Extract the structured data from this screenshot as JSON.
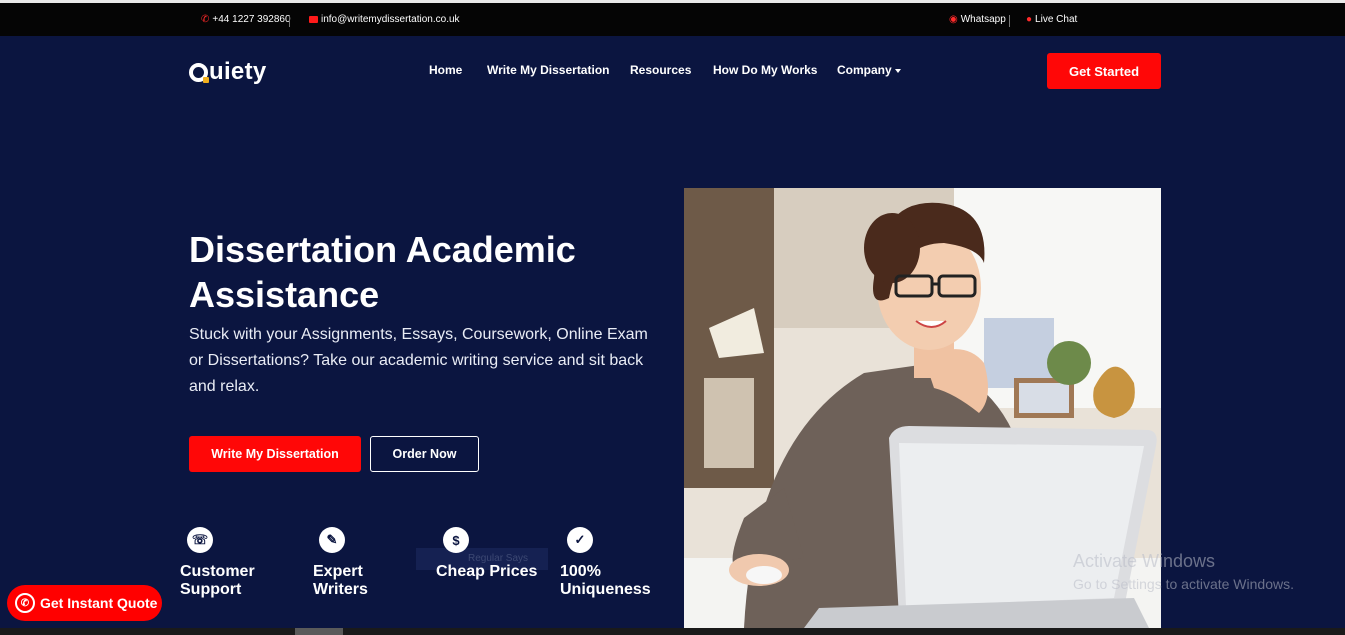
{
  "topbar": {
    "phone": "+44 1227 392860",
    "email": "info@writemydissertation.co.uk",
    "whatsapp": "Whatsapp",
    "live_chat": "Live Chat"
  },
  "header": {
    "logo": "uiety",
    "nav": [
      "Home",
      "Write My Dissertation",
      "Resources",
      "How Do My Works",
      "Company"
    ],
    "cta": "Get Started"
  },
  "hero": {
    "title_line1": "Dissertation Academic",
    "title_line2": "Assistance",
    "subtitle": "Stuck with your Assignments, Essays, Coursework, Online Exam or Dissertations? Take our academic writing service and sit back and relax.",
    "primary_button": "Write My Dissertation",
    "secondary_button": "Order Now"
  },
  "features": [
    {
      "line1": "Customer",
      "line2": "Support",
      "icon": "headset-icon"
    },
    {
      "line1": "Expert",
      "line2": "Writers",
      "icon": "writer-icon"
    },
    {
      "line1": "Cheap Prices",
      "line2": "",
      "icon": "price-icon"
    },
    {
      "line1": "100%",
      "line2": "Uniqueness",
      "icon": "unique-icon"
    }
  ],
  "ghost_text": "Regular Says",
  "quote_button": "Get Instant Quote",
  "watermark": {
    "title": "Activate Windows",
    "subtitle": "Go to Settings to activate Windows."
  },
  "colors": {
    "background": "#0b1540",
    "accent": "#ff0707",
    "topbar": "#050505"
  }
}
